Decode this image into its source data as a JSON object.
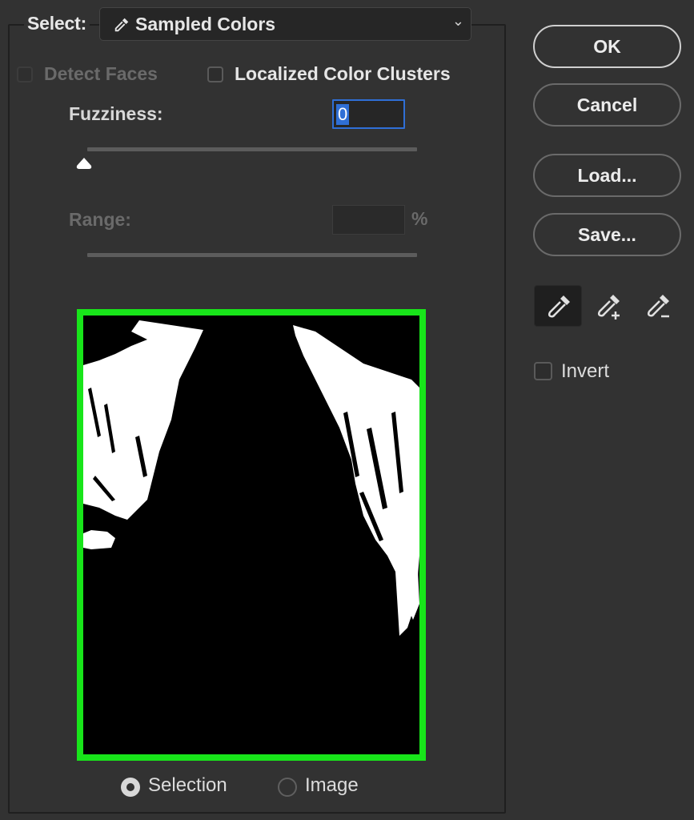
{
  "dialog": {
    "select_label": "Select:",
    "select_value": "Sampled Colors",
    "select_icon": "eyedropper-icon",
    "detect_faces": {
      "label": "Detect Faces",
      "checked": false,
      "enabled": false
    },
    "localized_clusters": {
      "label": "Localized Color Clusters",
      "checked": false,
      "enabled": true
    },
    "fuzziness": {
      "label": "Fuzziness:",
      "value": "0",
      "slider_fraction": 0.0
    },
    "range": {
      "label": "Range:",
      "value": "",
      "unit": "%",
      "enabled": false
    },
    "preview": {
      "frame_color": "#18e51a",
      "mode_options": [
        "Selection",
        "Image"
      ],
      "selected_mode": "Selection"
    },
    "radio_selection": "Selection",
    "radio_image": "Image"
  },
  "buttons": {
    "ok": "OK",
    "cancel": "Cancel",
    "load": "Load...",
    "save": "Save..."
  },
  "tools": [
    {
      "name": "eyedropper-icon",
      "active": true
    },
    {
      "name": "eyedropper-plus-icon",
      "active": false
    },
    {
      "name": "eyedropper-minus-icon",
      "active": false
    }
  ],
  "invert": {
    "label": "Invert",
    "checked": false
  },
  "colors": {
    "accent": "#2f6fd6",
    "preview_frame": "#18e51a",
    "background": "#323232"
  }
}
